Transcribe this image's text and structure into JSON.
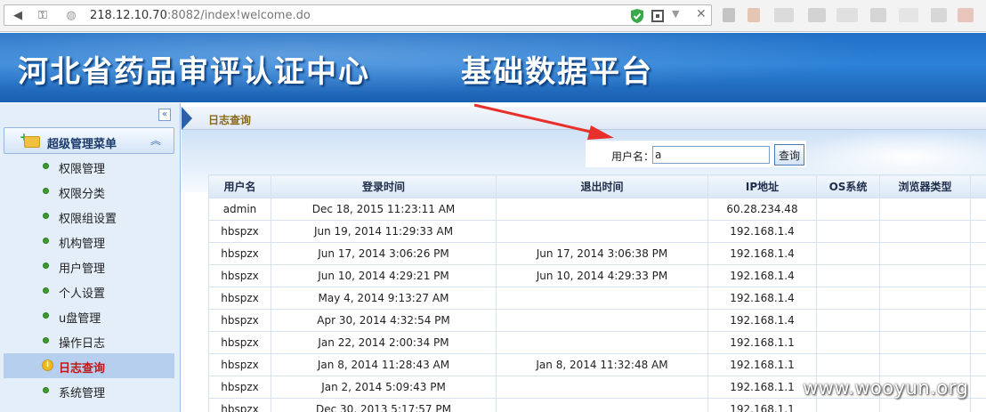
{
  "browser": {
    "url_host": "218.12.10.70",
    "url_rest": ":8082/index!welcome.do"
  },
  "banner": {
    "title_left": "河北省药品审评认证中心",
    "title_right": "基础数据平台"
  },
  "sidebar": {
    "collapse_icon": "«",
    "menu_title": "超级管理菜单",
    "items": [
      {
        "label": "权限管理"
      },
      {
        "label": "权限分类"
      },
      {
        "label": "权限组设置"
      },
      {
        "label": "机构管理"
      },
      {
        "label": "用户管理"
      },
      {
        "label": "个人设置"
      },
      {
        "label": "u盘管理"
      },
      {
        "label": "操作日志"
      },
      {
        "label": "日志查询"
      },
      {
        "label": "系统管理"
      }
    ],
    "active_index": 8
  },
  "main": {
    "tab_title": "日志查询",
    "search": {
      "label": "用户名：",
      "value": "a",
      "button": "查询"
    },
    "table": {
      "columns": [
        "用户名",
        "登录时间",
        "退出时间",
        "IP地址",
        "OS系统",
        "浏览器类型"
      ],
      "rows": [
        [
          "admin",
          "Dec 18, 2015 11:23:11 AM",
          "",
          "60.28.234.48",
          "",
          ""
        ],
        [
          "hbspzx",
          "Jun 19, 2014 11:29:33 AM",
          "",
          "192.168.1.4",
          "",
          ""
        ],
        [
          "hbspzx",
          "Jun 17, 2014 3:06:26 PM",
          "Jun 17, 2014 3:06:38 PM",
          "192.168.1.4",
          "",
          ""
        ],
        [
          "hbspzx",
          "Jun 10, 2014 4:29:21 PM",
          "Jun 10, 2014 4:29:33 PM",
          "192.168.1.4",
          "",
          ""
        ],
        [
          "hbspzx",
          "May 4, 2014 9:13:27 AM",
          "",
          "192.168.1.4",
          "",
          ""
        ],
        [
          "hbspzx",
          "Apr 30, 2014 4:32:54 PM",
          "",
          "192.168.1.4",
          "",
          ""
        ],
        [
          "hbspzx",
          "Jan 22, 2014 2:00:34 PM",
          "",
          "192.168.1.1",
          "",
          ""
        ],
        [
          "hbspzx",
          "Jan 8, 2014 11:28:43 AM",
          "Jan 8, 2014 11:32:48 AM",
          "192.168.1.1",
          "",
          ""
        ],
        [
          "hbspzx",
          "Jan 2, 2014 5:09:43 PM",
          "",
          "192.168.1.1",
          "",
          ""
        ],
        [
          "hbspzx",
          "Dec 30, 2013 5:17:57 PM",
          "",
          "192.168.1.1",
          "",
          ""
        ]
      ]
    }
  },
  "watermark": "www.wooyun.org",
  "colors": {
    "banner": "#2c82d8",
    "arrow": "#e8302a",
    "active_item": "#c01818"
  }
}
